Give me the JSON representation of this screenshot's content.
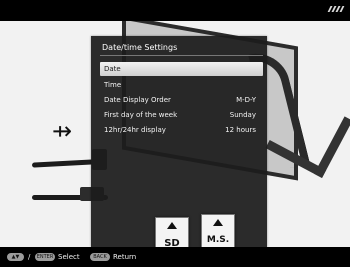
{
  "menu": {
    "title": "Date/time Settings",
    "items": [
      {
        "label": "Date",
        "value": ""
      },
      {
        "label": "Time",
        "value": ""
      },
      {
        "label": "Date Display Order",
        "value": "M-D-Y"
      },
      {
        "label": "First day of the week",
        "value": "Sunday"
      },
      {
        "label": "12hr/24hr display",
        "value": "12 hours"
      }
    ]
  },
  "cards": {
    "sd": "SD",
    "ms": "M.S."
  },
  "footer": {
    "arrow_key": "▲▼",
    "slash": "/",
    "enter_key": "ENTER",
    "select_label": "Select",
    "back_key": "BACK",
    "return_label": "Return"
  },
  "icons": {
    "usb": "usb-icon",
    "status": "status-icon"
  },
  "colors": {
    "menu_background": "#1c1c1c",
    "selected_row": "#eeeeee",
    "background": "#f2f2f2"
  }
}
